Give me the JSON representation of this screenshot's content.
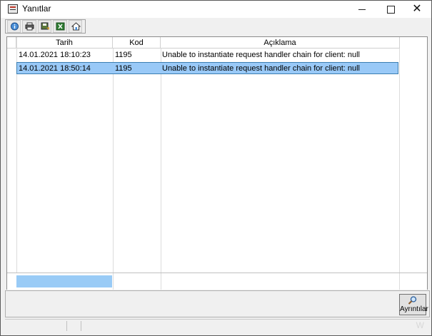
{
  "window": {
    "title": "Yanıtlar"
  },
  "toolbar": {
    "buttons": [
      {
        "icon": "info-globe-icon"
      },
      {
        "icon": "printer-icon"
      },
      {
        "icon": "save-export-icon"
      },
      {
        "icon": "excel-icon"
      },
      {
        "icon": "home-export-icon"
      }
    ]
  },
  "grid": {
    "columns": [
      "Tarih",
      "Kod",
      "Açıklama"
    ],
    "rows": [
      {
        "date": "14.01.2021 18:10:23",
        "code": "1195",
        "description": "Unable to instantiate request handler chain for client: null",
        "selected": false
      },
      {
        "date": "14.01.2021 18:50:14",
        "code": "1195",
        "description": "Unable to instantiate request handler chain for client: null",
        "selected": true
      }
    ]
  },
  "details_button": {
    "label": "Ayrıntılar",
    "icon": "magnifier-icon"
  },
  "status": {
    "watermark": "W"
  },
  "colors": {
    "selection": "#99c9f7",
    "selection_border": "#3c7fb1",
    "window_bg": "#f0f0f0"
  }
}
